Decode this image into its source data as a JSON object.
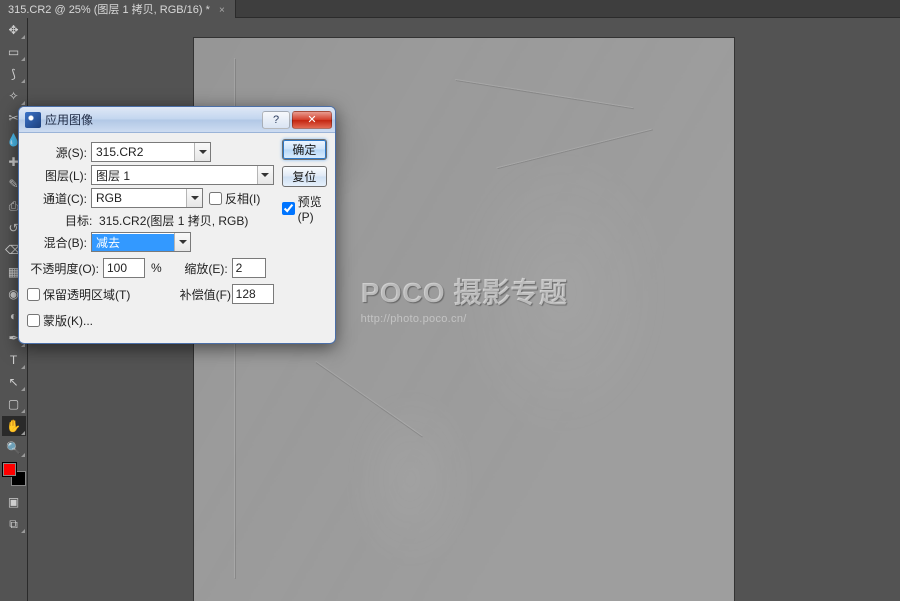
{
  "tab": {
    "label": "315.CR2 @ 25% (图层 1 拷贝, RGB/16) *"
  },
  "watermark": {
    "brand": "POCO",
    "text": "摄影专题",
    "url": "http://photo.poco.cn/"
  },
  "dialog": {
    "title": "应用图像",
    "buttons": {
      "ok": "确定",
      "reset": "复位"
    },
    "preview": {
      "label": "预览(P)",
      "checked": true
    },
    "source_label": "源(S):",
    "source_value": "315.CR2",
    "layer_label": "图层(L):",
    "layer_value": "图层 1",
    "channel_label": "通道(C):",
    "channel_value": "RGB",
    "invert": {
      "label": "反相(I)",
      "checked": false
    },
    "target_label": "目标:",
    "target_value": "315.CR2(图层 1 拷贝, RGB)",
    "blend_label": "混合(B):",
    "blend_value": "减去",
    "opacity_label": "不透明度(O):",
    "opacity_value": "100",
    "opacity_unit": "%",
    "scale_label": "缩放(E):",
    "scale_value": "2",
    "offset_label": "补偿值(F):",
    "offset_value": "128",
    "preserve_trans": {
      "label": "保留透明区域(T)",
      "checked": false
    },
    "mask": {
      "label": "蒙版(K)...",
      "checked": false
    }
  },
  "tools": [
    {
      "name": "move-tool",
      "glyph": "✥"
    },
    {
      "name": "marquee-tool",
      "glyph": "▭"
    },
    {
      "name": "lasso-tool",
      "glyph": "⟆"
    },
    {
      "name": "magic-wand-tool",
      "glyph": "✧"
    },
    {
      "name": "crop-tool",
      "glyph": "✂"
    },
    {
      "name": "eyedropper-tool",
      "glyph": "💧"
    },
    {
      "name": "healing-brush-tool",
      "glyph": "✚"
    },
    {
      "name": "brush-tool",
      "glyph": "✎"
    },
    {
      "name": "clone-stamp-tool",
      "glyph": "⎙"
    },
    {
      "name": "history-brush-tool",
      "glyph": "↺"
    },
    {
      "name": "eraser-tool",
      "glyph": "⌫"
    },
    {
      "name": "gradient-tool",
      "glyph": "▦"
    },
    {
      "name": "blur-tool",
      "glyph": "◉"
    },
    {
      "name": "dodge-tool",
      "glyph": "◐"
    },
    {
      "name": "pen-tool",
      "glyph": "✒"
    },
    {
      "name": "type-tool",
      "glyph": "T"
    },
    {
      "name": "path-select-tool",
      "glyph": "↖"
    },
    {
      "name": "shape-tool",
      "glyph": "▢"
    },
    {
      "name": "hand-tool",
      "glyph": "✋"
    },
    {
      "name": "zoom-tool",
      "glyph": "🔍"
    }
  ]
}
